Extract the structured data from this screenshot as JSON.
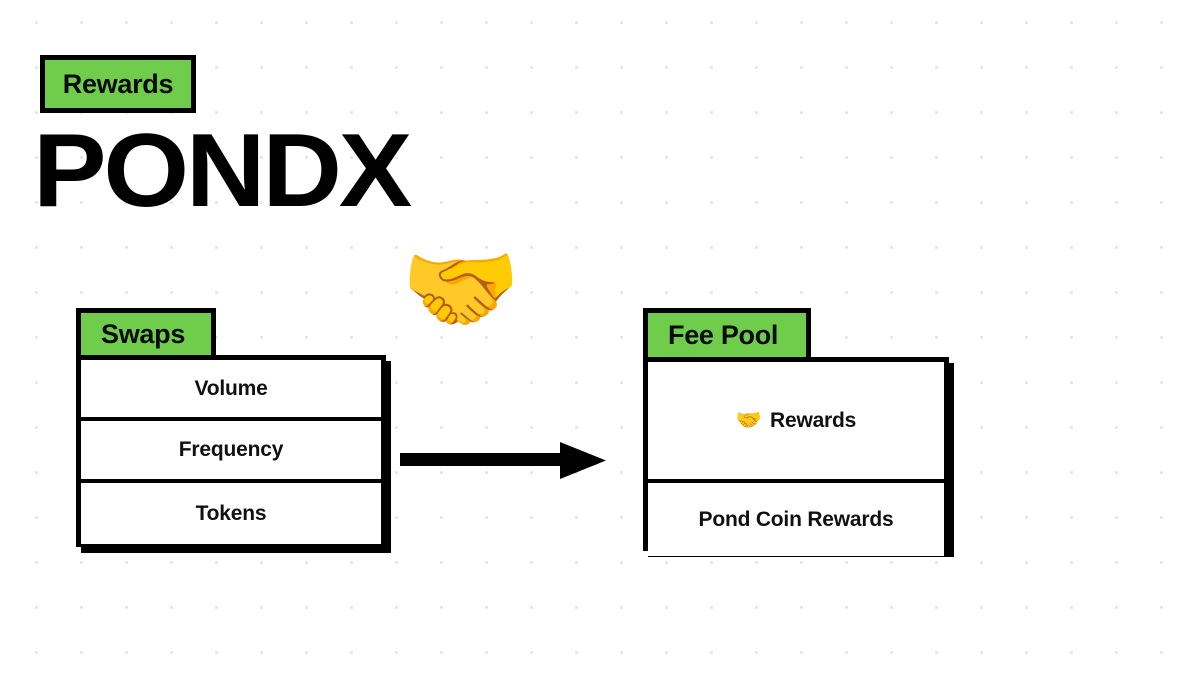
{
  "background": {
    "color": "#ffffff",
    "dot_color": "#e6e6e6",
    "dot_spacing_px": 45
  },
  "theme": {
    "accent_green": "#6fcd4b",
    "ink_black": "#000000",
    "card_white": "#ffffff"
  },
  "badge": {
    "label": "Rewards"
  },
  "logo": {
    "wordmark": "PONDX",
    "emoji": "🤝",
    "emoji_name": "handshake-emoji"
  },
  "diagram": {
    "arrow": {
      "direction": "right",
      "from": "Swaps",
      "to": "Fee Pool"
    },
    "source_card": {
      "tab_label": "Swaps",
      "rows": [
        {
          "label": "Volume"
        },
        {
          "label": "Frequency"
        },
        {
          "label": "Tokens"
        }
      ]
    },
    "target_card": {
      "tab_label": "Fee Pool",
      "rows": [
        {
          "emoji": "🤝",
          "label": "Rewards"
        },
        {
          "label": "Pond Coin Rewards"
        }
      ]
    }
  }
}
